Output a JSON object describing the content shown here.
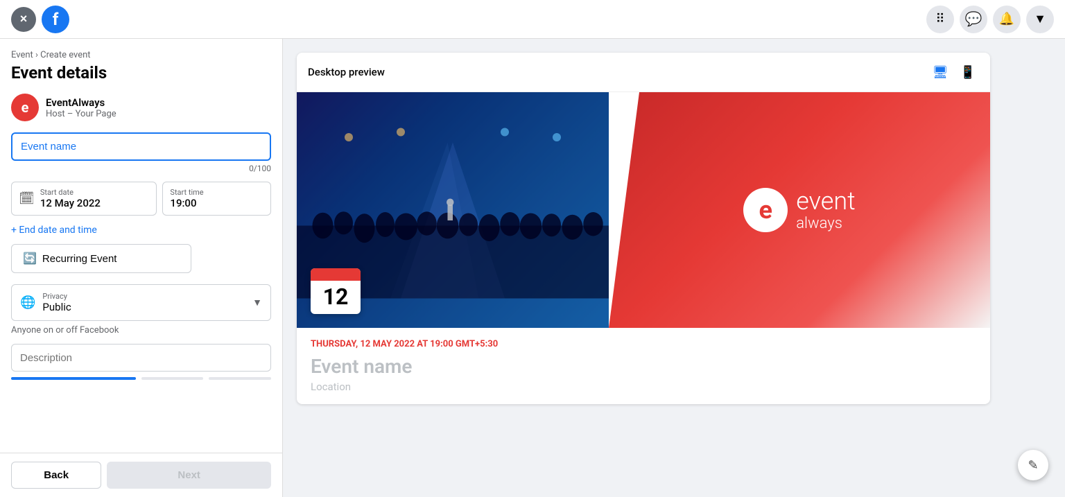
{
  "topnav": {
    "close_label": "×",
    "fb_label": "f",
    "icons": {
      "grid": "⠿",
      "messenger": "💬",
      "bell": "🔔",
      "arrow": "▼"
    }
  },
  "left_panel": {
    "breadcrumb": "Event › Create event",
    "page_title": "Event details",
    "host": {
      "avatar_letter": "e",
      "name": "EventAlways",
      "sub": "Host – Your Page"
    },
    "event_name_placeholder": "Event name",
    "char_count": "0/100",
    "start_date_label": "Start date",
    "start_date_value": "12 May 2022",
    "start_time_label": "Start time",
    "start_time_value": "19:00",
    "end_date_link": "+ End date and time",
    "recurring_label": "Recurring Event",
    "privacy_label": "Privacy",
    "privacy_value": "Public",
    "privacy_note": "Anyone on or off Facebook",
    "description_placeholder": "Description",
    "back_label": "Back",
    "next_label": "Next"
  },
  "right_panel": {
    "preview_title": "Desktop preview",
    "desktop_icon": "🖥",
    "mobile_icon": "📱",
    "event_date_display": "THURSDAY, 12 MAY 2022 AT 19:00 GMT+5:30",
    "event_name_display": "Event name",
    "event_location_display": "Location",
    "date_number": "12",
    "brand": {
      "letter": "e",
      "name": "event",
      "sub": "always"
    }
  },
  "progress": {
    "filled_color": "#1877f2",
    "empty_color": "#e4e6eb"
  }
}
